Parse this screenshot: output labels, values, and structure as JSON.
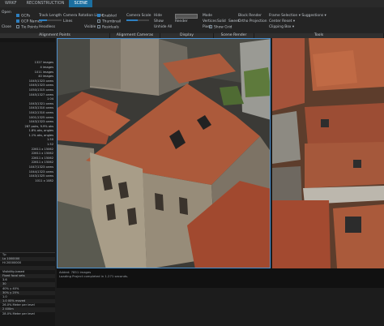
{
  "tabs": [
    "WRKF",
    "RECONSTRUCTION",
    "SCENE"
  ],
  "active_tab": 2,
  "ribbon": {
    "left_items": [
      "Close",
      "Open"
    ],
    "gcps": "GCPs",
    "gcp_names": "GCP Names",
    "tie_points": "Tie Points",
    "track_length": "Track Length",
    "camera_rotation_lines": "Camera Rotation Lines",
    "lines_label": "Lines",
    "headless": "Headless",
    "visible": "Visible",
    "enabled": "Enabled",
    "thumbnail": "Thumbnail",
    "residuals": "Residuals",
    "camera_scale": "Camera Scale",
    "hide": "Hide",
    "show": "Show",
    "grid_label": "Grid",
    "render_value": "Render",
    "pixel_label": "Pixel",
    "mode_label": "Mode",
    "mode_options": [
      "Vertices",
      "Solid",
      "Sweet"
    ],
    "block_render": "Block Render",
    "ortho_projection": "Ortho Projection",
    "show_grid": "Show Grid",
    "frame_selection": "Frame Selection",
    "suggestions": "Suggestions",
    "center_reset": "Center Reset",
    "clipping_box": "Clipping Box",
    "unhide_all": "Unhide All",
    "scene_render_button": "Scene Render"
  },
  "panel_headers": [
    "Alignment Points",
    "Alignment Cameras",
    "Display",
    "Scene Render",
    "Tools"
  ],
  "left_list": [
    "",
    "",
    "",
    "",
    "1327 images",
    "4 images",
    "1011 images",
    "40 images",
    "1045/1323 cams",
    "1045/1323 cams",
    "1050/1315 cams",
    "1045/1327 cams",
    "1 04",
    "1043/1321 cams",
    "1043/1310 cams",
    "1042/1310 cams",
    "1001/1325 cams",
    "1043/1323 cams",
    "287 pairs, 9.9% oks",
    "1.8% oks, angles",
    "1.1% oks, angles",
    "1.50",
    "1.52",
    "22611 x 15062",
    "22611 x 15062",
    "22611 x 15062",
    "22611 x 15062",
    "1047/1323 cams",
    "1044/1323 cams",
    "1043/1325 cams",
    "1011 x 1082"
  ],
  "lower_list": [
    "Tp",
    "Lo  1000000",
    "Hi  20000000",
    "",
    "Visibility-based",
    "Fixed focal sets",
    "3.6",
    "30",
    "40% y 40%",
    "30% y 25%",
    "1.0",
    "1.0 00% moved",
    "26.0% Meter per level",
    "2 400m",
    "28.0% Meter per level"
  ],
  "status": {
    "line1": "Added: 7851 images",
    "line2": "Loading Project completed in 1.271 seconds."
  },
  "colors": {
    "accent": "#2d7fc0",
    "active_tab": "#1b6fa0",
    "roof": "#a9563a",
    "wall": "#8c8476"
  }
}
